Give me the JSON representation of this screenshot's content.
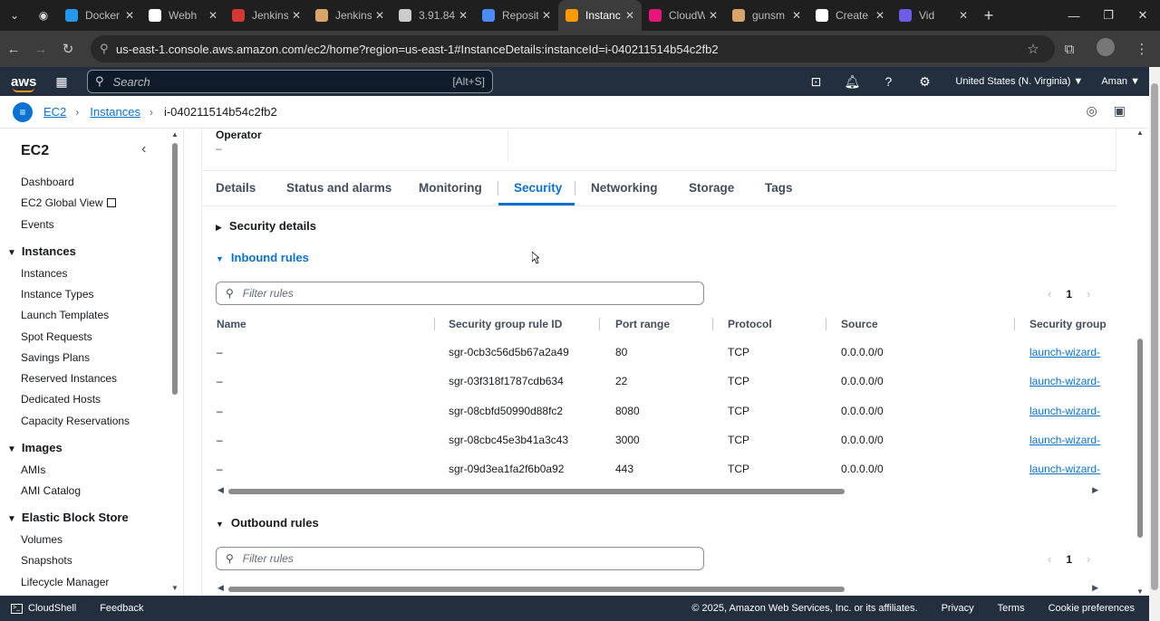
{
  "browser": {
    "tabs": [
      {
        "title": "Docker",
        "color": "#2496ed"
      },
      {
        "title": "Webh",
        "color": "#ffffff"
      },
      {
        "title": "Jenkins",
        "color": "#d33833"
      },
      {
        "title": "Jenkins",
        "color": "#d9a46a"
      },
      {
        "title": "3.91.84",
        "color": "#cccccc"
      },
      {
        "title": "Reposit",
        "color": "#4c8bf5"
      },
      {
        "title": "Instanc",
        "color": "#ff9900",
        "active": true
      },
      {
        "title": "CloudW",
        "color": "#e7157b"
      },
      {
        "title": "gunsm",
        "color": "#d9a46a"
      },
      {
        "title": "Create",
        "color": "#ffffff"
      },
      {
        "title": "Vid",
        "color": "#6c5ce7"
      }
    ],
    "url": "us-east-1.console.aws.amazon.com/ec2/home?region=us-east-1#InstanceDetails:instanceId=i-040211514b54c2fb2"
  },
  "aws_nav": {
    "logo": "aws",
    "search_placeholder": "Search",
    "search_shortcut": "[Alt+S]",
    "region": "United States (N. Virginia) ▼",
    "user": "Aman ▼"
  },
  "breadcrumb": {
    "items": [
      "EC2",
      "Instances",
      "i-040211514b54c2fb2"
    ]
  },
  "sidebar": {
    "title": "EC2",
    "top_items": [
      "Dashboard",
      "EC2 Global View",
      "Events"
    ],
    "sections": [
      {
        "title": "Instances",
        "items": [
          "Instances",
          "Instance Types",
          "Launch Templates",
          "Spot Requests",
          "Savings Plans",
          "Reserved Instances",
          "Dedicated Hosts",
          "Capacity Reservations"
        ]
      },
      {
        "title": "Images",
        "items": [
          "AMIs",
          "AMI Catalog"
        ]
      },
      {
        "title": "Elastic Block Store",
        "items": [
          "Volumes",
          "Snapshots",
          "Lifecycle Manager"
        ]
      }
    ]
  },
  "operator": {
    "label": "Operator",
    "value": "–"
  },
  "tabs": [
    "Details",
    "Status and alarms",
    "Monitoring",
    "Security",
    "Networking",
    "Storage",
    "Tags"
  ],
  "active_tab": "Security",
  "security_details_label": "Security details",
  "inbound": {
    "title": "Inbound rules",
    "filter_placeholder": "Filter rules",
    "page": "1",
    "columns": [
      "Name",
      "Security group rule ID",
      "Port range",
      "Protocol",
      "Source",
      "Security group"
    ],
    "rows": [
      {
        "name": "–",
        "rule_id": "sgr-0cb3c56d5b67a2a49",
        "port": "80",
        "protocol": "TCP",
        "source": "0.0.0.0/0",
        "sg": "launch-wizard-"
      },
      {
        "name": "–",
        "rule_id": "sgr-03f318f1787cdb634",
        "port": "22",
        "protocol": "TCP",
        "source": "0.0.0.0/0",
        "sg": "launch-wizard-"
      },
      {
        "name": "–",
        "rule_id": "sgr-08cbfd50990d88fc2",
        "port": "8080",
        "protocol": "TCP",
        "source": "0.0.0.0/0",
        "sg": "launch-wizard-"
      },
      {
        "name": "–",
        "rule_id": "sgr-08cbc45e3b41a3c43",
        "port": "3000",
        "protocol": "TCP",
        "source": "0.0.0.0/0",
        "sg": "launch-wizard-"
      },
      {
        "name": "–",
        "rule_id": "sgr-09d3ea1fa2f6b0a92",
        "port": "443",
        "protocol": "TCP",
        "source": "0.0.0.0/0",
        "sg": "launch-wizard-"
      }
    ]
  },
  "outbound": {
    "title": "Outbound rules",
    "filter_placeholder": "Filter rules",
    "page": "1"
  },
  "footer": {
    "cloudshell": "CloudShell",
    "feedback": "Feedback",
    "copyright": "© 2025, Amazon Web Services, Inc. or its affiliates.",
    "privacy": "Privacy",
    "terms": "Terms",
    "cookies": "Cookie preferences"
  }
}
